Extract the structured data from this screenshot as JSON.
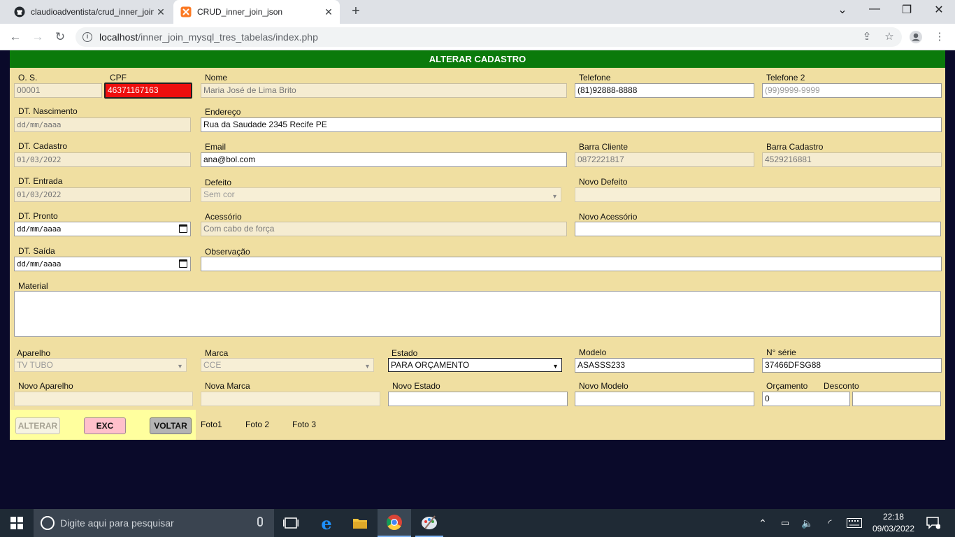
{
  "browser": {
    "tabs": [
      {
        "title": "claudioadventista/crud_inner_join",
        "icon": "github-icon",
        "active": false
      },
      {
        "title": "CRUD_inner_join_json",
        "icon": "xampp-icon",
        "active": true
      }
    ],
    "url_host": "localhost",
    "url_path": "/inner_join_mysql_tres_tabelas/index.php"
  },
  "form": {
    "title": "ALTERAR CADASTRO",
    "labels": {
      "os": "O. S.",
      "cpf": "CPF",
      "nome": "Nome",
      "telefone": "Telefone",
      "telefone2": "Telefone 2",
      "dt_nascimento": "DT. Nascimento",
      "endereco": "Endereço",
      "dt_cadastro": "DT. Cadastro",
      "email": "Email",
      "barra_cliente": "Barra Cliente",
      "barra_cadastro": "Barra Cadastro",
      "dt_entrada": "DT. Entrada",
      "defeito": "Defeito",
      "novo_defeito": "Novo Defeito",
      "dt_pronto": "DT. Pronto",
      "acessorio": "Acessório",
      "novo_acessorio": "Novo Acessório",
      "dt_saida": "DT. Saída",
      "observacao": "Observação",
      "material": "Material",
      "aparelho": "Aparelho",
      "marca": "Marca",
      "estado": "Estado",
      "modelo": "Modelo",
      "n_serie": "N° série",
      "novo_aparelho": "Novo Aparelho",
      "nova_marca": "Nova Marca",
      "novo_estado": "Novo Estado",
      "novo_modelo": "Novo Modelo",
      "orcamento": "Orçamento",
      "desconto": "Desconto"
    },
    "values": {
      "os": "00001",
      "cpf": "46371167163",
      "nome": "Maria José de Lima Brito",
      "telefone": "(81)92888-8888",
      "telefone2_placeholder": "(99)9999-9999",
      "dt_nascimento": "dd/mm/aaaa",
      "endereco": "Rua da Saudade 2345 Recife PE",
      "dt_cadastro": "01/03/2022",
      "email": "ana@bol.com",
      "barra_cliente": "0872221817",
      "barra_cadastro": "4529216881",
      "dt_entrada": "01/03/2022",
      "defeito": "Sem cor",
      "novo_defeito": "",
      "dt_pronto": "dd/mm/aaaa",
      "acessorio": "Com cabo de força",
      "novo_acessorio": "",
      "dt_saida": "dd/mm/aaaa",
      "observacao": "",
      "material": "",
      "aparelho": "TV TUBO",
      "marca": "CCE",
      "estado": "PARA ORÇAMENTO",
      "modelo": "ASASSS233",
      "n_serie": "37466DFSG88",
      "novo_aparelho": "",
      "nova_marca": "",
      "novo_estado": "",
      "novo_modelo": "",
      "orcamento": "0",
      "desconto": ""
    },
    "buttons": {
      "alterar": "ALTERAR",
      "exc": "EXC",
      "voltar": "VOLTAR"
    },
    "fotos": [
      "Foto1",
      "Foto 2",
      "Foto 3"
    ]
  },
  "taskbar": {
    "search_placeholder": "Digite aqui para pesquisar",
    "time": "22:18",
    "date": "09/03/2022"
  },
  "colors": {
    "header": "#0b7a0b",
    "form_bg": "#f0dfa1",
    "cpf_bg": "#ee0e0e",
    "button_area": "#ffff9e"
  }
}
